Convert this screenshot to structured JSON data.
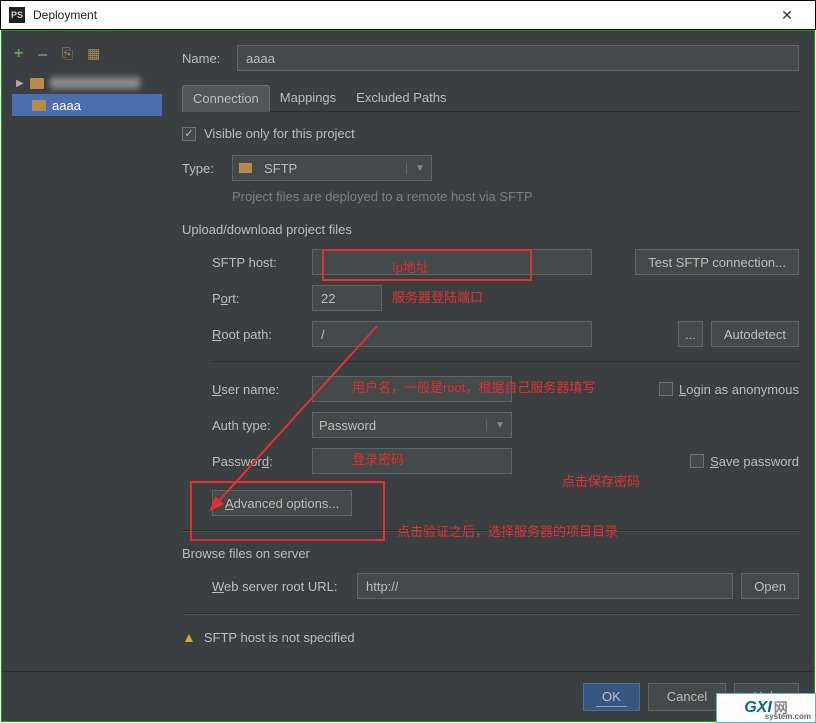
{
  "window": {
    "title": "Deployment"
  },
  "sidebar": {
    "items": [
      {
        "label": ""
      },
      {
        "label": "aaaa"
      }
    ]
  },
  "name_label": "Name:",
  "name_value": "aaaa",
  "tabs": [
    "Connection",
    "Mappings",
    "Excluded Paths"
  ],
  "visible_only_label": "Visible only for this project",
  "type_label": "Type:",
  "type_value": "SFTP",
  "type_hint": "Project files are deployed to a remote host via SFTP",
  "section1": "Upload/download project files",
  "fields": {
    "sftp_host_label": "SFTP host:",
    "sftp_host_value": "",
    "test_btn": "Test SFTP connection...",
    "port_label_pre": "P",
    "port_label_u": "o",
    "port_label_post": "rt:",
    "port_value": "22",
    "root_label_u": "R",
    "root_label_post": "oot path:",
    "root_value": "/",
    "root_browse": "...",
    "autodetect": "Autodetect",
    "user_label_u": "U",
    "user_label_post": "ser name:",
    "user_value": "",
    "login_anon_u": "L",
    "login_anon_post": "ogin as anonymous",
    "auth_label": "Auth type:",
    "auth_value": "Password",
    "pass_label": "Passwor",
    "pass_label_u": "d",
    "pass_label_post": ":",
    "pass_value": "",
    "save_pass_u": "S",
    "save_pass_post": "ave password",
    "adv_u": "A",
    "adv_post": "dvanced options..."
  },
  "section2": "Browse files on server",
  "web_label_u": "W",
  "web_label_post": "eb server root URL:",
  "web_value": "http://",
  "open_btn": "Open",
  "warning_text": "SFTP host is not specified",
  "buttons": {
    "ok": "OK",
    "cancel": "Cancel",
    "help": "Help"
  },
  "annotations": {
    "ip": "Ip地址",
    "port": "服务器登陆端口",
    "user": "用户名，一般是root，根据自己服务器填写",
    "pass": "登录密码",
    "save": "点击保存密码",
    "adv": "点击验证之后，选择服务器的项目目录"
  },
  "logo": {
    "main": "GXI",
    "suffix": "网",
    "domain": "system.com"
  }
}
